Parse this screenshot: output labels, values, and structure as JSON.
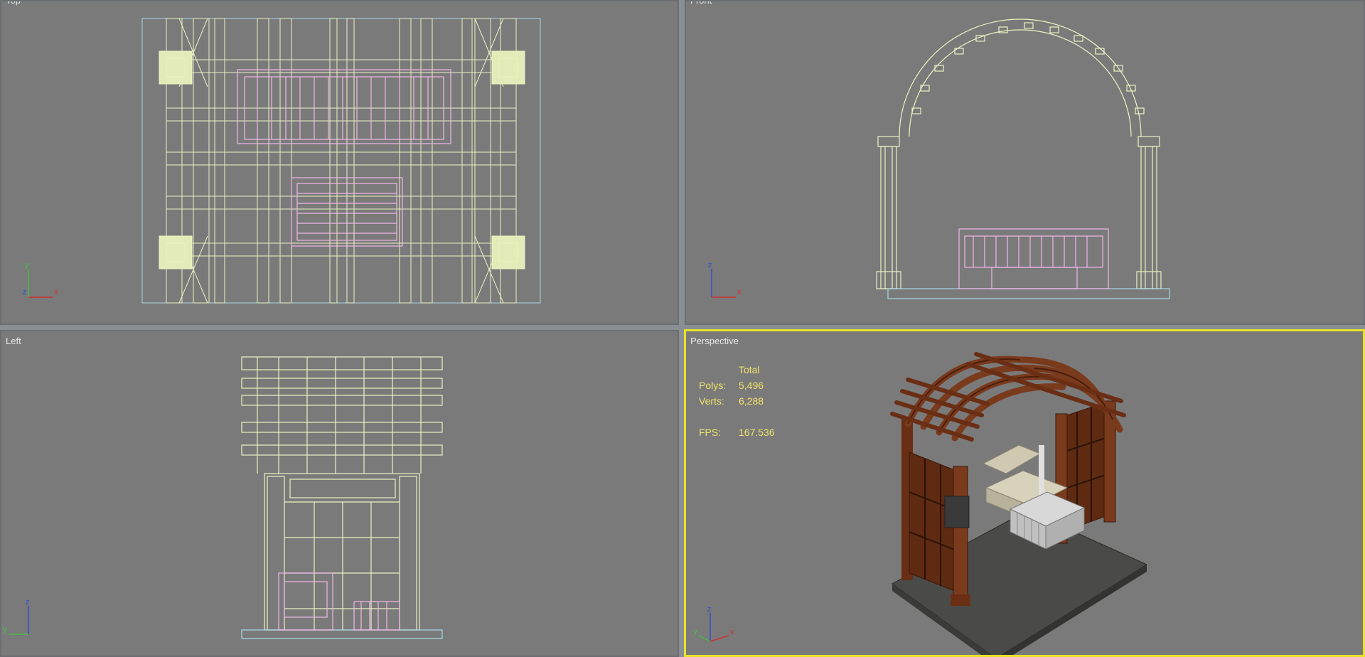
{
  "viewports": {
    "top": {
      "label": "Top"
    },
    "front": {
      "label": "Front"
    },
    "left": {
      "label": "Left"
    },
    "perspective": {
      "label": "Perspective"
    }
  },
  "stats": {
    "header": "Total",
    "polys_label": "Polys:",
    "polys_value": "5,496",
    "verts_label": "Verts:",
    "verts_value": "6,288",
    "fps_label": "FPS:",
    "fps_value": "167.536"
  },
  "axes": {
    "top": {
      "v": "y",
      "mid": "z",
      "h": "x"
    },
    "front": {
      "v": "z",
      "mid": "",
      "h": "x"
    },
    "left": {
      "v": "z",
      "mid": "y",
      "h": ""
    },
    "perspective": {
      "v": "z",
      "mid": "y",
      "h": "x"
    }
  },
  "colors": {
    "viewport_bg": "#7a7a7a",
    "wire": "#ecf3c4",
    "furniture_wire": "#f2b7e9",
    "active_border": "#e8e22a",
    "stats_text": "#f0e36a",
    "wood": "#7a3a1c",
    "bounds": "#a8d8e8"
  }
}
